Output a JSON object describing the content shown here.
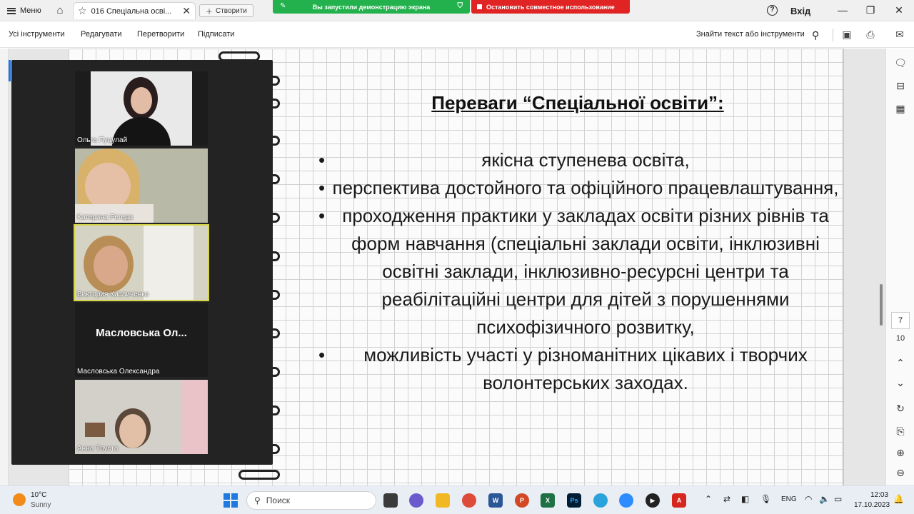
{
  "titlebar": {
    "menu_label": "Меню",
    "tab_title": "016 Спеціальна осві...",
    "new_tab_label": "Створити",
    "share_status": "Вы запустили демонстрацию экрана",
    "stop_share": "Остановить совместное использование",
    "login_label": "Вхід"
  },
  "toolbar": {
    "items": [
      "Усі інструменти",
      "Редагувати",
      "Перетворити",
      "Підписати"
    ],
    "find_label": "Знайти текст або інструменти"
  },
  "slide": {
    "title": "Переваги “Спеціальної освіти”:",
    "bullets": [
      "якісна ступенева освіта,",
      "перспектива достойного та офіційного працевлаштування,",
      "проходження практики у закладах освіти різних рівнів та форм навчання (спеціальні заклади освіти, інклюзивні освітні заклади, інклюзивно-ресурсні центри та реабілітаційні центри для дітей з порушеннями психофізичного розвитку,",
      "можливість участі у різноманітних цікавих і творчих волонтерських заходах."
    ]
  },
  "video": {
    "participants": [
      {
        "name": "Ольга Пуцулай",
        "active": false
      },
      {
        "name": "Катерина Регеда",
        "active": false
      },
      {
        "name": "Виктория Кисличенко",
        "active": true
      },
      {
        "name": "Масловська Олександра",
        "active": false,
        "initials_label": "Масловська  Ол..."
      },
      {
        "name": "Анна Тлуста",
        "active": false
      }
    ]
  },
  "pager": {
    "current": "7",
    "total": "10"
  },
  "taskbar": {
    "temp": "10°C",
    "weather": "Sunny",
    "search_placeholder": "Поиск",
    "lang": "ENG",
    "time": "12:03",
    "date": "17.10.2023"
  },
  "colors": {
    "share_green": "#22b14c",
    "share_red": "#e02424",
    "active_tile": "#d6d64a"
  }
}
